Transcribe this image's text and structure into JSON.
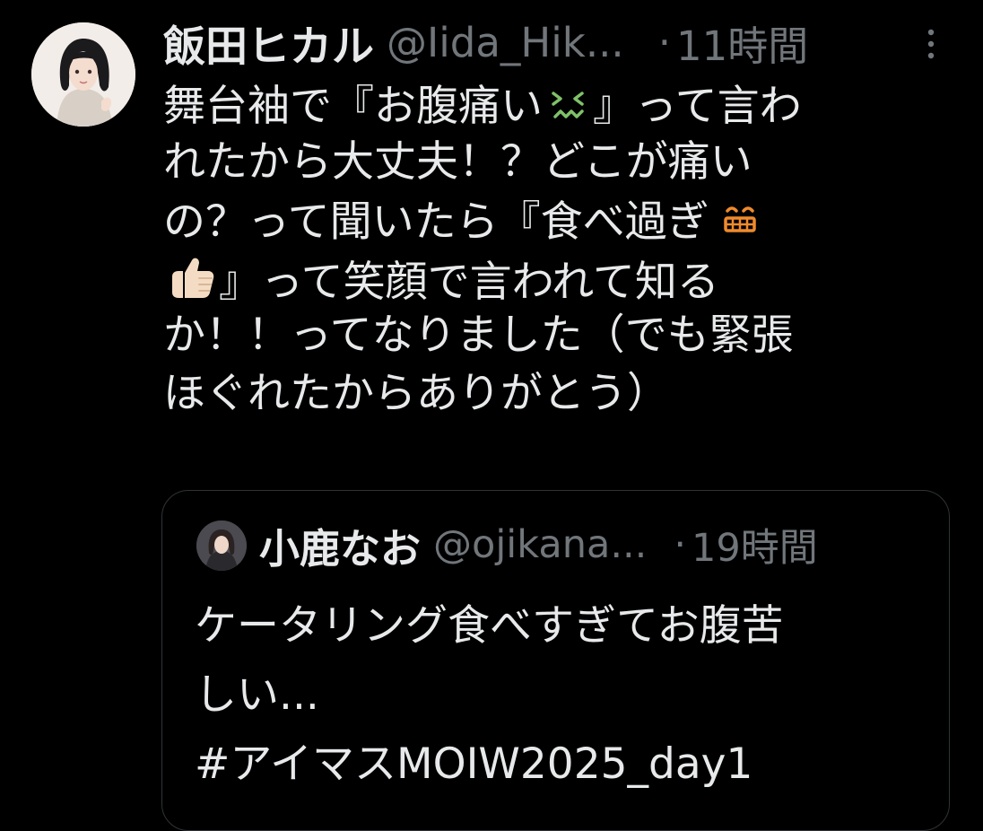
{
  "tweet": {
    "author_name": "飯田ヒカル",
    "author_handle": "@Iida_Hik...",
    "separator": "·",
    "time": "11時間",
    "lines": [
      {
        "a": "舞台袖で『お腹痛い",
        "b": "』って言わ"
      },
      {
        "a": "れたから大丈夫！？どこが痛い"
      },
      {
        "a": "の？って聞いたら『食べ過ぎ"
      },
      {
        "a": "』って笑顔で言われて知る"
      },
      {
        "a": "か！！ってなりました（でも緊張"
      },
      {
        "a": "ほぐれたからありがとう）"
      }
    ],
    "emojis": [
      "confounded-face-icon",
      "grinning-teeth-face-icon",
      "thumbs-up-icon"
    ]
  },
  "quoted": {
    "author_name": "小鹿なお",
    "author_handle": "@ojikana...",
    "separator": "·",
    "time": "19時間",
    "lines": [
      "ケータリング食べすぎてお腹苦",
      "しい...",
      "#アイマスMOIW2025_day1"
    ]
  },
  "colors": {
    "background": "#000000",
    "text_primary": "#e7e9ea",
    "text_secondary": "#71767b",
    "border": "#2f3336",
    "emoji_green": "#7fc16a",
    "emoji_orange": "#ef8a2d",
    "emoji_skin": "#f4dcc4"
  }
}
